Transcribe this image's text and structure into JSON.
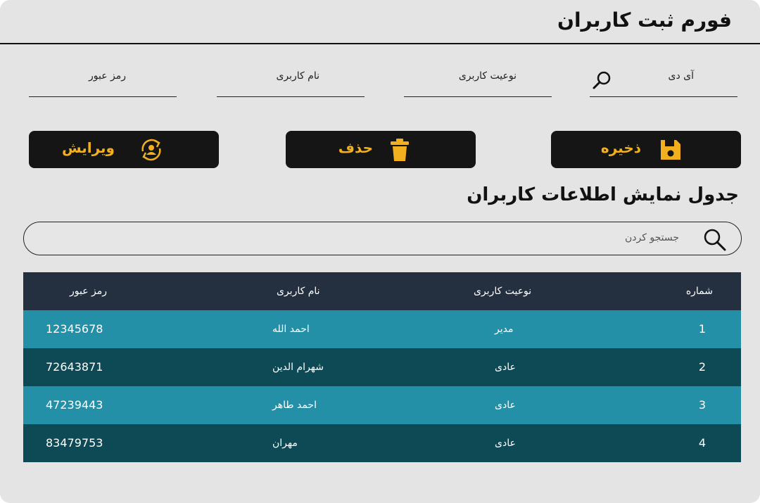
{
  "header": {
    "title": "فورم ثبت کاربران"
  },
  "form": {
    "fields": [
      {
        "label": "آی دی",
        "icon": "search-icon"
      },
      {
        "label": "نوعیت کاربری"
      },
      {
        "label": "نام کاربری"
      },
      {
        "label": "رمز عبور"
      }
    ]
  },
  "actions": {
    "save_label": "ذخیره",
    "delete_label": "حذف",
    "edit_label": "ویرایش",
    "accent_color": "#f2b01e"
  },
  "table_section": {
    "title": "جدول نمایش اطلاعات کاربران",
    "search_placeholder": "جستجو کردن",
    "columns": [
      "شماره",
      "نوعیت کاربری",
      "نام کاربری",
      "رمز عبور"
    ],
    "rows": [
      [
        "1",
        "مدیر",
        "احمد الله",
        "12345678"
      ],
      [
        "2",
        "عادی",
        "شهرام الدین",
        "72643871"
      ],
      [
        "3",
        "عادی",
        "احمد طاهر",
        "47239443"
      ],
      [
        "4",
        "عادی",
        "مهران",
        "83479753"
      ]
    ]
  },
  "colors": {
    "header_row": "#24303f",
    "row_light": "#2390a8",
    "row_dark": "#0d4a56",
    "button_bg": "#151515"
  }
}
